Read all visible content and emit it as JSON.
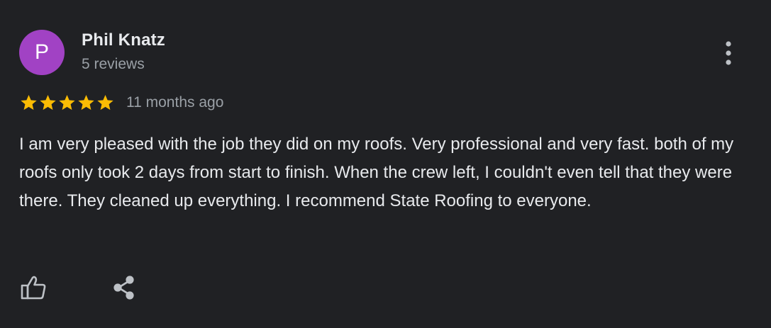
{
  "author": {
    "initial": "P",
    "name": "Phil Knatz",
    "meta": "5 reviews",
    "avatar_color": "#a142c4"
  },
  "rating": {
    "stars": 5,
    "max": 5,
    "star_color": "#fbbc04"
  },
  "review": {
    "date": "11 months ago",
    "text": "I am very pleased with the job they did on my roofs. Very professional and very fast. both of my roofs only took 2 days from start to finish. When the crew left, I couldn't even tell that they were there. They cleaned up everything. I recommend State Roofing to everyone."
  },
  "actions": {
    "more_icon": "more-vert-icon",
    "like_icon": "thumbs-up-icon",
    "share_icon": "share-icon"
  },
  "colors": {
    "background": "#202124",
    "primary_text": "#e8eaed",
    "secondary_text": "#9aa0a6"
  }
}
